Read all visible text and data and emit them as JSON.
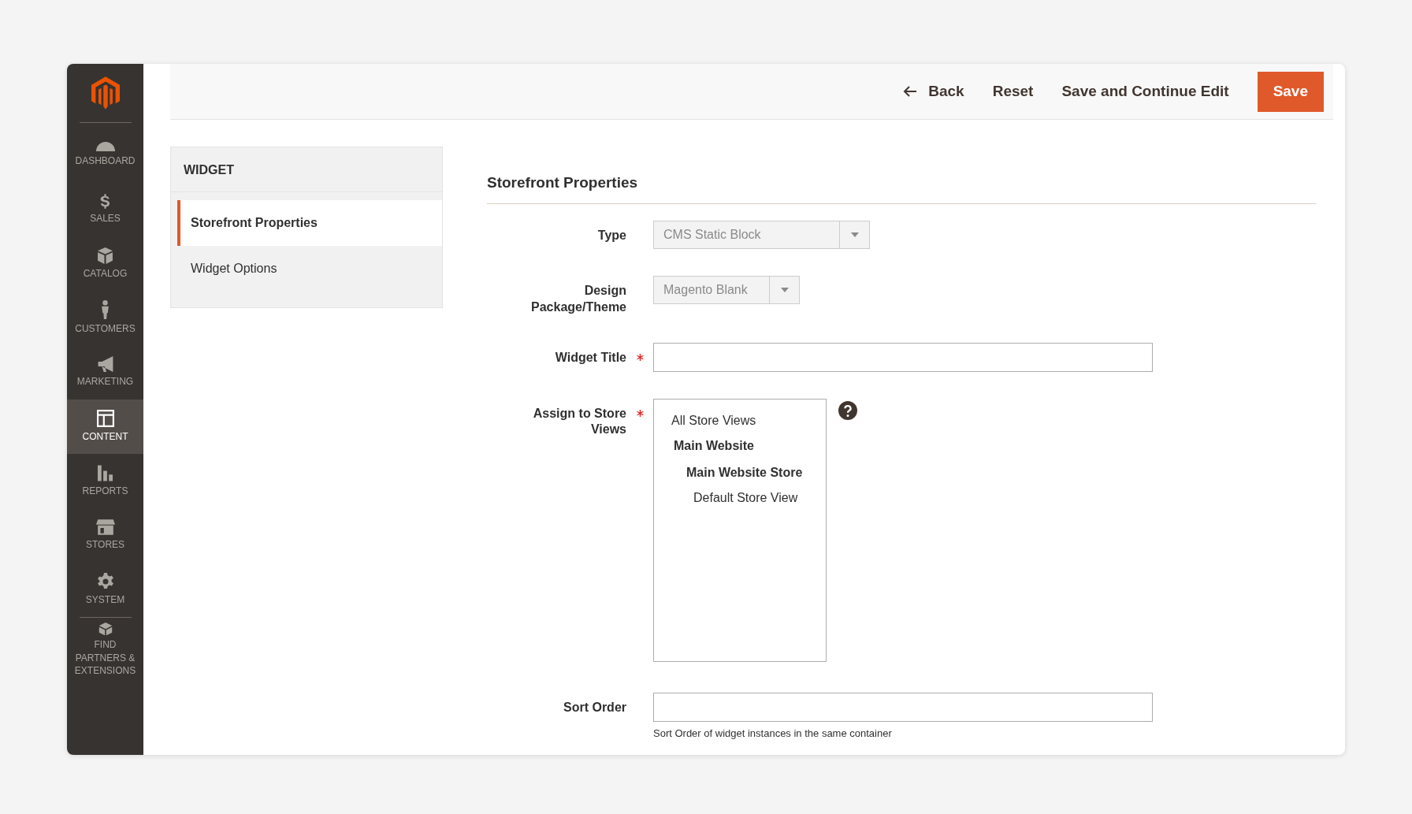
{
  "sidebar": {
    "items": [
      {
        "label": "DASHBOARD",
        "selected": false
      },
      {
        "label": "SALES",
        "selected": false
      },
      {
        "label": "CATALOG",
        "selected": false
      },
      {
        "label": "CUSTOMERS",
        "selected": false
      },
      {
        "label": "MARKETING",
        "selected": false
      },
      {
        "label": "CONTENT",
        "selected": true
      },
      {
        "label": "REPORTS",
        "selected": false
      },
      {
        "label": "STORES",
        "selected": false
      },
      {
        "label": "SYSTEM",
        "selected": false
      },
      {
        "label": "FIND PARTNERS & EXTENSIONS",
        "selected": false
      }
    ]
  },
  "header": {
    "back": "Back",
    "buttons": [
      {
        "label": "Reset",
        "kind": "plain"
      },
      {
        "label": "Save and Continue Edit",
        "kind": "plain"
      },
      {
        "label": "Save",
        "kind": "primary"
      }
    ]
  },
  "tabs": {
    "title": "WIDGET",
    "items": [
      {
        "label": "Storefront Properties",
        "selected": true
      },
      {
        "label": "Widget Options",
        "selected": false
      }
    ]
  },
  "section": {
    "title": "Storefront Properties",
    "fields": [
      {
        "kind": "select",
        "label": "Type",
        "value": "CMS Static Block",
        "required": false
      },
      {
        "kind": "select",
        "label": "Design Package/Theme",
        "value": "Magento Blank",
        "required": false
      },
      {
        "kind": "text",
        "label": "Widget Title",
        "required": true
      },
      {
        "kind": "multiselect",
        "label": "Assign to Store Views",
        "required": true,
        "help": true,
        "options": [
          {
            "label": "All Store Views",
            "kind": "all"
          },
          {
            "label": "Main Website",
            "kind": "website"
          },
          {
            "label": "Main Website Store",
            "kind": "store"
          },
          {
            "label": "Default Store View",
            "kind": "view"
          }
        ]
      },
      {
        "kind": "text",
        "label": "Sort Order",
        "required": false,
        "note": "Sort Order of widget instances in the same container"
      }
    ]
  }
}
